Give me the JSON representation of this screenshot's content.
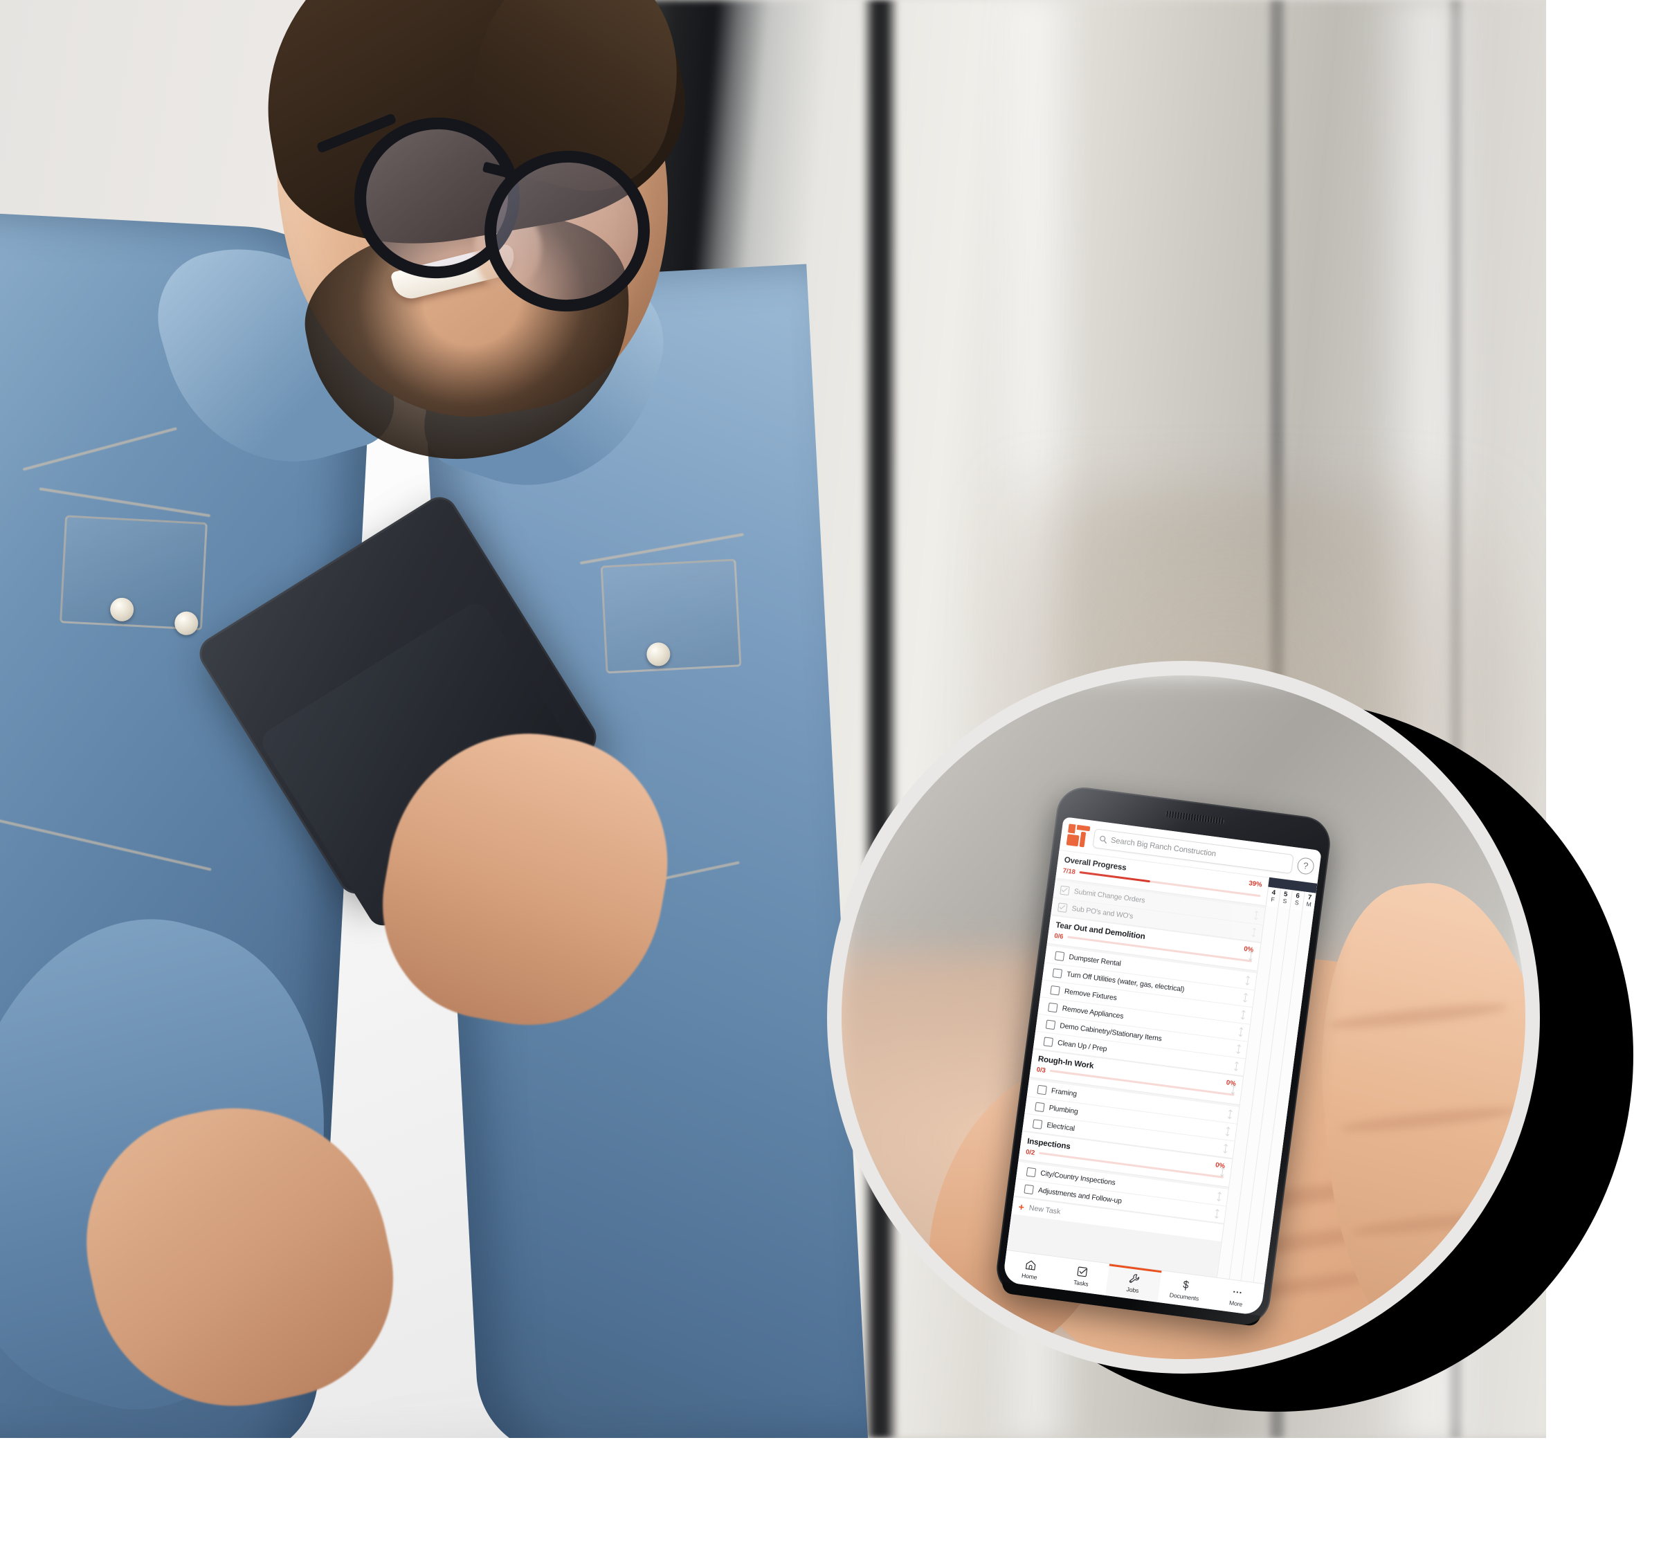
{
  "scene": {
    "description": "Smiling bearded man in denim shirt holding a dark tablet; circular callout at right shows a hand holding a smartphone running a construction project management app"
  },
  "phone_app": {
    "topbar": {
      "logo_icon": "buildertrend-logo-icon",
      "search_placeholder": "Search Big Ranch Construction",
      "search_value": "",
      "search_icon": "search-icon",
      "help_icon": "help-circle-icon",
      "help_label": "?"
    },
    "overall": {
      "title": "Overall Progress",
      "fraction": "7/18",
      "percent_label": "39%",
      "percent_value": 39
    },
    "ungrouped_tasks": [
      {
        "label": "Submit Change Orders",
        "checked": true,
        "drag_icon": "drag-handle-icon"
      },
      {
        "label": "Sub PO's and WO's",
        "checked": true,
        "drag_icon": "drag-handle-icon"
      }
    ],
    "groups": [
      {
        "title": "Tear Out and Demolition",
        "fraction": "0/6",
        "percent_label": "0%",
        "percent_value": 0,
        "tasks": [
          {
            "label": "Dumpster Rental",
            "checked": false
          },
          {
            "label": "Turn Off Utilities (water, gas, electrical)",
            "checked": false
          },
          {
            "label": "Remove Fixtures",
            "checked": false
          },
          {
            "label": "Remove Appliances",
            "checked": false
          },
          {
            "label": "Demo Cabinetry/Stationary Items",
            "checked": false
          },
          {
            "label": "Clean Up / Prep",
            "checked": false
          }
        ]
      },
      {
        "title": "Rough-In Work",
        "fraction": "0/3",
        "percent_label": "0%",
        "percent_value": 0,
        "tasks": [
          {
            "label": "Framing",
            "checked": false
          },
          {
            "label": "Plumbing",
            "checked": false
          },
          {
            "label": "Electrical",
            "checked": false
          }
        ]
      },
      {
        "title": "Inspections",
        "fraction": "0/2",
        "percent_label": "0%",
        "percent_value": 0,
        "tasks": [
          {
            "label": "City/Country Inspections",
            "checked": false
          },
          {
            "label": "Adjustments and Follow-up",
            "checked": false
          }
        ]
      }
    ],
    "new_task": {
      "label": "New Task",
      "icon": "plus-icon"
    },
    "calendar": {
      "days": [
        {
          "number": "4",
          "letter": "F"
        },
        {
          "number": "5",
          "letter": "S"
        },
        {
          "number": "6",
          "letter": "S"
        },
        {
          "number": "7",
          "letter": "M"
        }
      ]
    },
    "bottom_nav": [
      {
        "label": "Home",
        "icon": "home-icon",
        "active": false
      },
      {
        "label": "Tasks",
        "icon": "checkbox-icon",
        "active": false
      },
      {
        "label": "Jobs",
        "icon": "wrench-icon",
        "active": true
      },
      {
        "label": "Documents",
        "icon": "dollar-icon",
        "active": false
      },
      {
        "label": "More",
        "icon": "ellipsis-icon",
        "active": false
      }
    ]
  },
  "colors": {
    "accent_orange": "#E8511F",
    "progress_red": "#D7392B",
    "progress_track": "#F7D9D6",
    "nav_dark": "#2C3242",
    "text_dark": "#1B1D21",
    "text_muted": "#8D8F92",
    "callout_ring": "#E9E8E6"
  }
}
